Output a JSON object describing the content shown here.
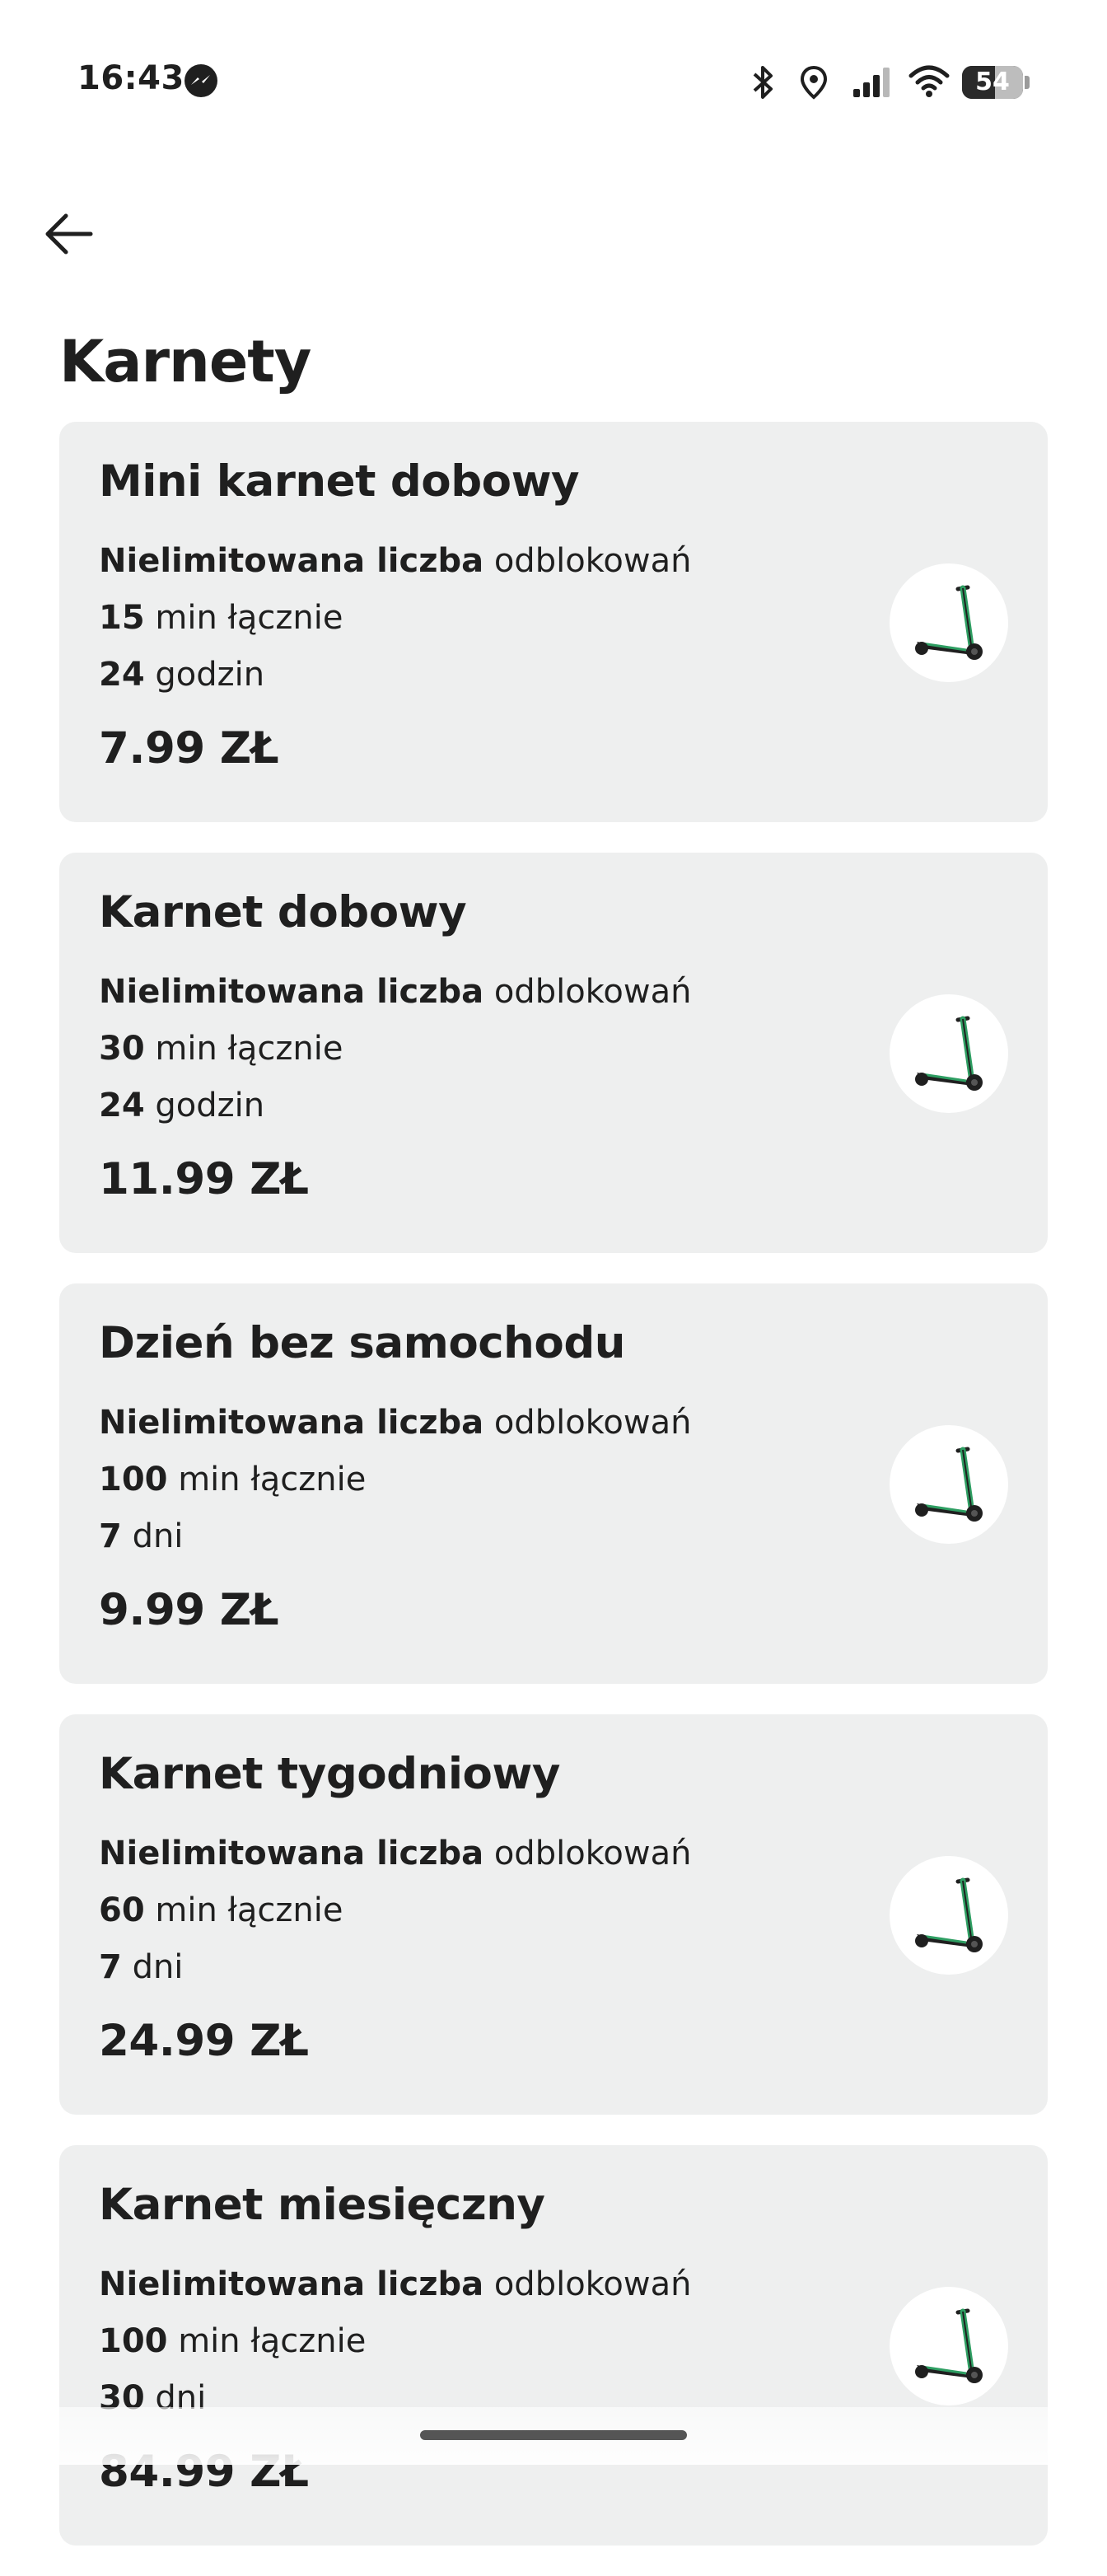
{
  "status_bar": {
    "time": "16:43",
    "battery_level": "54",
    "icons": [
      "messenger-icon",
      "bluetooth-icon",
      "location-icon",
      "signal-icon",
      "wifi-icon",
      "battery-icon"
    ]
  },
  "header": {
    "back_icon": "arrow-left-icon",
    "title": "Karnety"
  },
  "passes": [
    {
      "name": "Mini karnet dobowy",
      "unlocks_bold": "Nielimitowana liczba",
      "unlocks_text": "odblokowań",
      "minutes_bold": "15",
      "minutes_text": "min łącznie",
      "duration_bold": "24",
      "duration_text": "godzin",
      "price": "7.99 ZŁ",
      "image": "scooter-icon"
    },
    {
      "name": "Karnet dobowy",
      "unlocks_bold": "Nielimitowana liczba",
      "unlocks_text": "odblokowań",
      "minutes_bold": "30",
      "minutes_text": "min łącznie",
      "duration_bold": "24",
      "duration_text": "godzin",
      "price": "11.99 ZŁ",
      "image": "scooter-icon"
    },
    {
      "name": "Dzień bez samochodu",
      "unlocks_bold": "Nielimitowana liczba",
      "unlocks_text": "odblokowań",
      "minutes_bold": "100",
      "minutes_text": "min łącznie",
      "duration_bold": "7",
      "duration_text": "dni",
      "price": "9.99 ZŁ",
      "image": "scooter-icon"
    },
    {
      "name": "Karnet tygodniowy",
      "unlocks_bold": "Nielimitowana liczba",
      "unlocks_text": "odblokowań",
      "minutes_bold": "60",
      "minutes_text": "min łącznie",
      "duration_bold": "7",
      "duration_text": "dni",
      "price": "24.99 ZŁ",
      "image": "scooter-icon"
    },
    {
      "name": "Karnet miesięczny",
      "unlocks_bold": "Nielimitowana liczba",
      "unlocks_text": "odblokowań",
      "minutes_bold": "100",
      "minutes_text": "min łącznie",
      "duration_bold": "30",
      "duration_text": "dni",
      "price": "84.99 ZŁ",
      "image": "scooter-icon"
    }
  ],
  "colors": {
    "card_background": "#eeefef",
    "scooter_accent": "#2e9e62",
    "text": "#1f1f1f"
  }
}
